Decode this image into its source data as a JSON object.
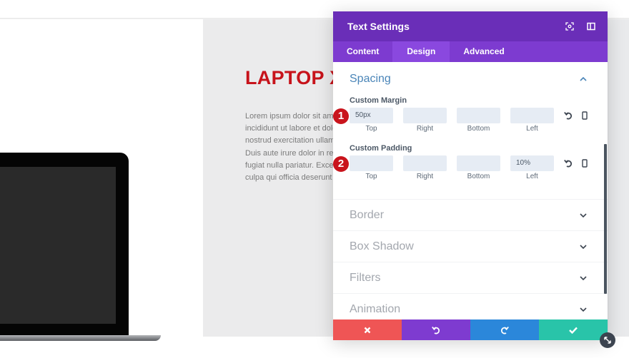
{
  "page": {
    "hero_title": "LAPTOP X",
    "hero_text_lines": [
      "Lorem ipsum dolor sit amet",
      "incididunt ut labore et dolore",
      "nostrud exercitation ullamco",
      "Duis aute irure dolor in repre",
      "fugiat nulla pariatur. Excepte",
      "culpa qui officia deserunt mo"
    ]
  },
  "modal": {
    "title": "Text Settings",
    "header_icons": [
      "fullscreen-icon",
      "sidebar-toggle-icon"
    ],
    "tabs": [
      {
        "label": "Content",
        "active": false
      },
      {
        "label": "Design",
        "active": true
      },
      {
        "label": "Advanced",
        "active": false
      }
    ],
    "open_section": {
      "label": "Spacing",
      "groups": [
        {
          "badge": "1",
          "label": "Custom Margin",
          "fields": [
            {
              "caption": "Top",
              "value": "50px"
            },
            {
              "caption": "Right",
              "value": ""
            },
            {
              "caption": "Bottom",
              "value": ""
            },
            {
              "caption": "Left",
              "value": ""
            }
          ]
        },
        {
          "badge": "2",
          "label": "Custom Padding",
          "fields": [
            {
              "caption": "Top",
              "value": ""
            },
            {
              "caption": "Right",
              "value": ""
            },
            {
              "caption": "Bottom",
              "value": ""
            },
            {
              "caption": "Left",
              "value": "10%"
            }
          ]
        }
      ]
    },
    "collapsed_sections": [
      "Border",
      "Box Shadow",
      "Filters",
      "Animation"
    ],
    "footer": {
      "buttons": [
        {
          "name": "discard",
          "icon": "close-icon",
          "color": "#ef5555"
        },
        {
          "name": "undo",
          "icon": "undo-icon",
          "color": "#7e3bd0"
        },
        {
          "name": "redo",
          "icon": "redo-icon",
          "color": "#2b87da"
        },
        {
          "name": "save",
          "icon": "check-icon",
          "color": "#29c4a9"
        }
      ]
    }
  },
  "colors": {
    "header": "#6a2eb8",
    "tabs": "#7d3bd0",
    "active_tab": "#8a48df",
    "accent_title": "#c7131b",
    "section_open": "#4a85b8",
    "badge": "#c9141c"
  }
}
